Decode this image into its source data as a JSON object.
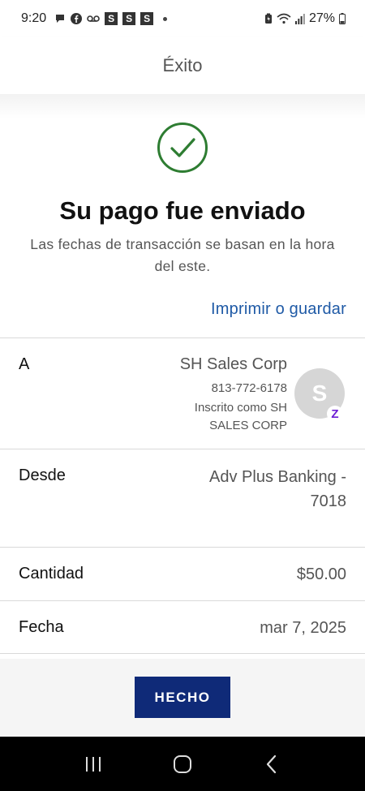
{
  "status_bar": {
    "time": "9:20",
    "notification_boxes": [
      "S",
      "S",
      "S"
    ],
    "battery": "27%"
  },
  "header": {
    "title": "Éxito"
  },
  "success": {
    "title": "Su pago fue enviado",
    "subtitle": "Las fechas de transacción se basan en la hora del este.",
    "print_link": "Imprimir o guardar"
  },
  "details": {
    "to": {
      "label": "A",
      "name": "SH Sales Corp",
      "phone": "813-772-6178",
      "enrolled_as": "Inscrito como SH SALES CORP",
      "avatar_letter": "S"
    },
    "from": {
      "label": "Desde",
      "value_line1": "Adv Plus Banking -",
      "value_line2": "7018"
    },
    "amount": {
      "label": "Cantidad",
      "value": "$50.00"
    },
    "date": {
      "label": "Fecha",
      "value": "mar 7, 2025"
    }
  },
  "footer": {
    "done_label": "HECHO"
  },
  "colors": {
    "success_green": "#2e7d32",
    "link_blue": "#1f5aa6",
    "button_navy": "#0f2a78",
    "zelle_purple": "#6d1ed4"
  }
}
